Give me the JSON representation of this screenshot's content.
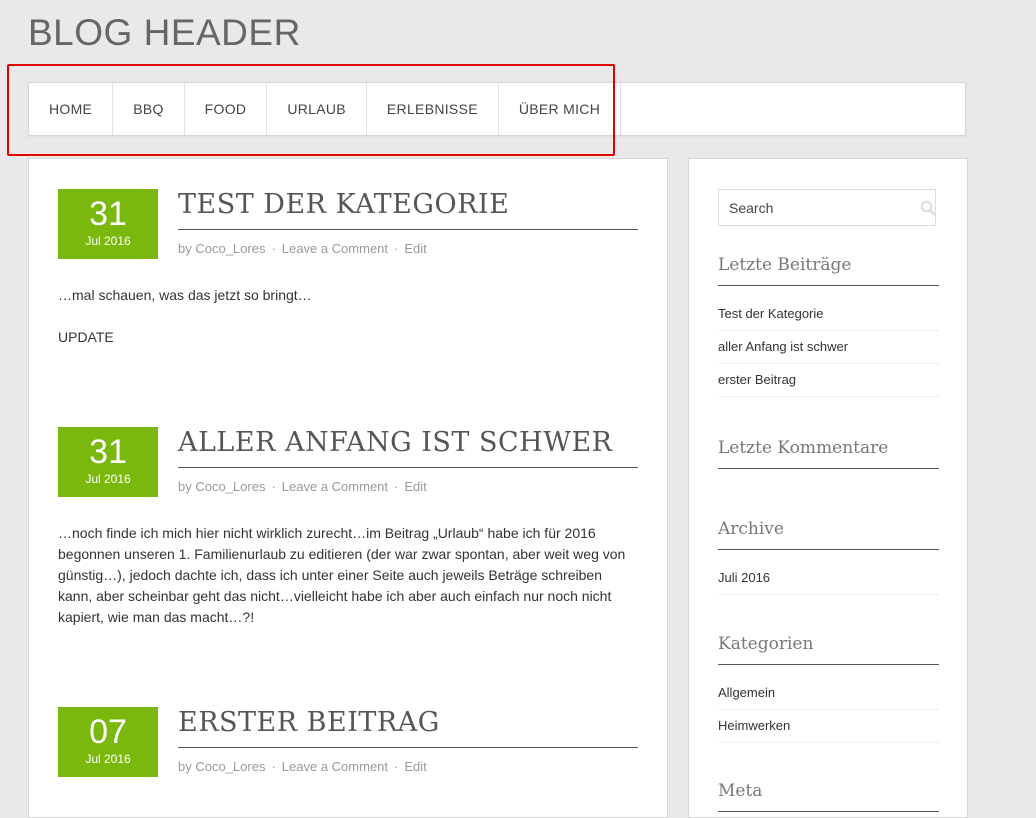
{
  "blog": {
    "title": "BLOG HEADER"
  },
  "nav": {
    "items": [
      {
        "label": "HOME"
      },
      {
        "label": "BBQ"
      },
      {
        "label": "FOOD"
      },
      {
        "label": "URLAUB"
      },
      {
        "label": "ERLEBNISSE"
      },
      {
        "label": "ÜBER MICH"
      }
    ]
  },
  "posts": [
    {
      "day": "31",
      "month": "Jul 2016",
      "title": "TEST DER KATEGORIE",
      "author": "by Coco_Lores",
      "comment": "Leave a Comment",
      "edit": "Edit",
      "paragraphs": [
        "…mal schauen, was das jetzt so bringt…",
        "UPDATE"
      ]
    },
    {
      "day": "31",
      "month": "Jul 2016",
      "title": "ALLER ANFANG IST SCHWER",
      "author": "by Coco_Lores",
      "comment": "Leave a Comment",
      "edit": "Edit",
      "paragraphs": [
        "…noch finde ich mich hier nicht wirklich zurecht…im Beitrag „Urlaub“ habe ich für 2016 begonnen unseren 1. Familienurlaub zu editieren (der war zwar spontan, aber weit weg von günstig…), jedoch dachte ich, dass ich unter einer Seite auch jeweils Beträge schreiben kann, aber scheinbar geht das nicht…vielleicht habe ich aber auch einfach nur noch nicht kapiert, wie man das macht…?!"
      ]
    },
    {
      "day": "07",
      "month": "Jul 2016",
      "title": "ERSTER BEITRAG",
      "author": "by Coco_Lores",
      "comment": "Leave a Comment",
      "edit": "Edit",
      "paragraphs": []
    }
  ],
  "sidebar": {
    "search": {
      "placeholder": "Search"
    },
    "recent_posts": {
      "title": "Letzte Beiträge",
      "items": [
        "Test der Kategorie",
        "aller Anfang ist schwer",
        "erster Beitrag"
      ]
    },
    "recent_comments": {
      "title": "Letzte Kommentare"
    },
    "archive": {
      "title": "Archive",
      "items": [
        "Juli 2016"
      ]
    },
    "categories": {
      "title": "Kategorien",
      "items": [
        "Allgemein",
        "Heimwerken"
      ]
    },
    "meta": {
      "title": "Meta"
    }
  },
  "colors": {
    "accent": "#7ab80e",
    "highlight": "#e00000"
  }
}
